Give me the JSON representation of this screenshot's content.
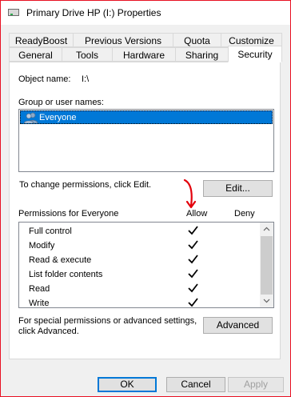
{
  "window": {
    "title": "Primary Drive HP (I:) Properties"
  },
  "tabs": {
    "row1": [
      "ReadyBoost",
      "Previous Versions",
      "Quota",
      "Customize"
    ],
    "row2": [
      "General",
      "Tools",
      "Hardware",
      "Sharing",
      "Security"
    ],
    "active": "Security"
  },
  "security": {
    "object_name_label": "Object name:",
    "object_name_value": "I:\\",
    "groups_label": "Group or user names:",
    "groups": [
      "Everyone"
    ],
    "change_hint": "To change permissions, click Edit.",
    "edit_button": "Edit...",
    "perms_header": "Permissions for Everyone",
    "allow_header": "Allow",
    "deny_header": "Deny",
    "permissions": [
      {
        "name": "Full control",
        "allow": true,
        "deny": false
      },
      {
        "name": "Modify",
        "allow": true,
        "deny": false
      },
      {
        "name": "Read & execute",
        "allow": true,
        "deny": false
      },
      {
        "name": "List folder contents",
        "allow": true,
        "deny": false
      },
      {
        "name": "Read",
        "allow": true,
        "deny": false
      },
      {
        "name": "Write",
        "allow": true,
        "deny": false
      }
    ],
    "advanced_hint_line1": "For special permissions or advanced settings,",
    "advanced_hint_line2": "click Advanced.",
    "advanced_button": "Advanced"
  },
  "footer": {
    "ok": "OK",
    "cancel": "Cancel",
    "apply": "Apply"
  },
  "colors": {
    "selection": "#0078d7",
    "annotation": "#e3000b"
  },
  "icons": {
    "title": "drive-icon",
    "group": "users-icon",
    "check": "check-icon"
  }
}
